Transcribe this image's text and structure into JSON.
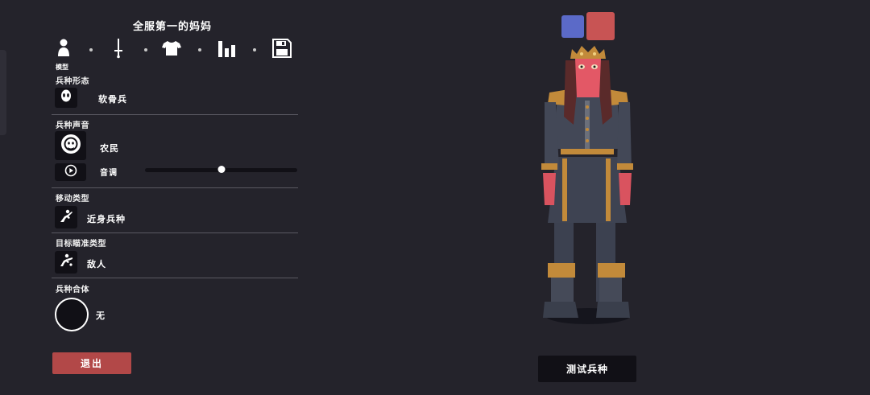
{
  "unit_name": "全服第一的妈妈",
  "tabs": [
    {
      "icon": "person-icon",
      "label": "模型"
    },
    {
      "icon": "sword-icon"
    },
    {
      "icon": "shirt-icon"
    },
    {
      "icon": "stats-bars-icon"
    },
    {
      "icon": "save-floppy-icon"
    }
  ],
  "sections": {
    "unit_form": {
      "label": "兵种形态",
      "value": "软骨兵",
      "icon": "skull-icon"
    },
    "unit_voice": {
      "label": "兵种声音",
      "value": "农民",
      "icon": "peasant-head-icon",
      "pitch_label": "音调",
      "pitch_level": 0.5,
      "play_icon": "play-icon"
    },
    "movement": {
      "label": "移动类型",
      "value": "近身兵种",
      "icon": "melee-icon"
    },
    "targeting": {
      "label": "目标瞄准类型",
      "value": "敌人",
      "icon": "target-enemy-icon"
    },
    "combine": {
      "label": "兵种合体",
      "value": "无"
    }
  },
  "buttons": {
    "exit": "退出",
    "test_unit": "测试兵种"
  },
  "team_colors": {
    "blue": "#5b6ac8",
    "red": "#c85454"
  },
  "colors": {
    "background": "#24232b",
    "panel_dark": "#111016",
    "exit_red": "#b24848"
  }
}
